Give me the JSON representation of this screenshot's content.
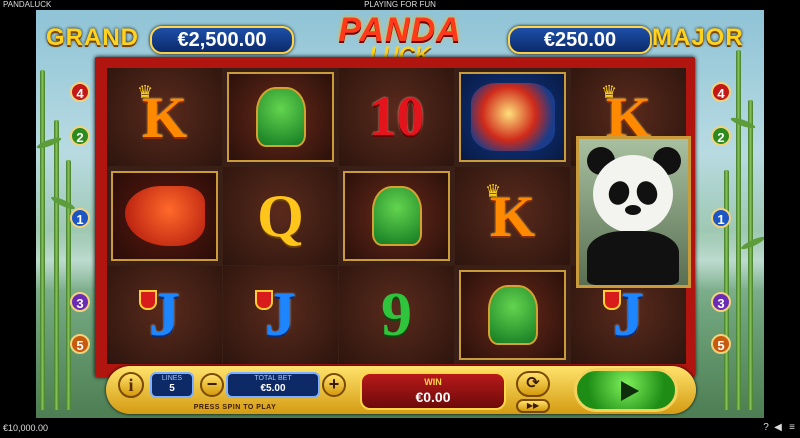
{
  "topbar": {
    "app_title": "PANDALUCK",
    "mode": "PLAYING FOR FUN"
  },
  "jackpots": {
    "grand_label": "GRAND",
    "grand_value": "€2,500.00",
    "major_label": "MAJOR",
    "major_value": "€250.00"
  },
  "logo": {
    "line1": "PANDA",
    "line2": "LUCK"
  },
  "reels": [
    [
      "K",
      "phoenix",
      "J"
    ],
    [
      "foo-dog",
      "Q",
      "J"
    ],
    [
      "10",
      "foo-dog",
      "9"
    ],
    [
      "dragon",
      "K",
      "foo-dog"
    ],
    [
      "K",
      "panda",
      "J"
    ]
  ],
  "paylines": {
    "left": [
      "4",
      "2",
      "1",
      "3",
      "5"
    ],
    "right": [
      "4",
      "2",
      "1",
      "3",
      "5"
    ]
  },
  "controls": {
    "info_label": "i",
    "lines_label": "LINES",
    "lines_value": "5",
    "minus_label": "−",
    "plus_label": "+",
    "total_bet_label": "TOTAL BET",
    "total_bet_value": "€5.00",
    "press_spin_text": "PRESS SPIN TO PLAY",
    "win_label": "WIN",
    "win_value": "€0.00",
    "autoplay_icon": "refresh-icon",
    "turbo_icon": "fast-forward-icon",
    "spin_icon": "play-icon"
  },
  "bottombar": {
    "balance": "€10,000.00",
    "help_icon": "help-icon",
    "sound_icon": "speaker-icon",
    "menu_icon": "menu-icon"
  },
  "colors": {
    "frame": "#b0160f",
    "jackpot_gold": "#ffd21f",
    "spin_green": "#2fc43b"
  }
}
